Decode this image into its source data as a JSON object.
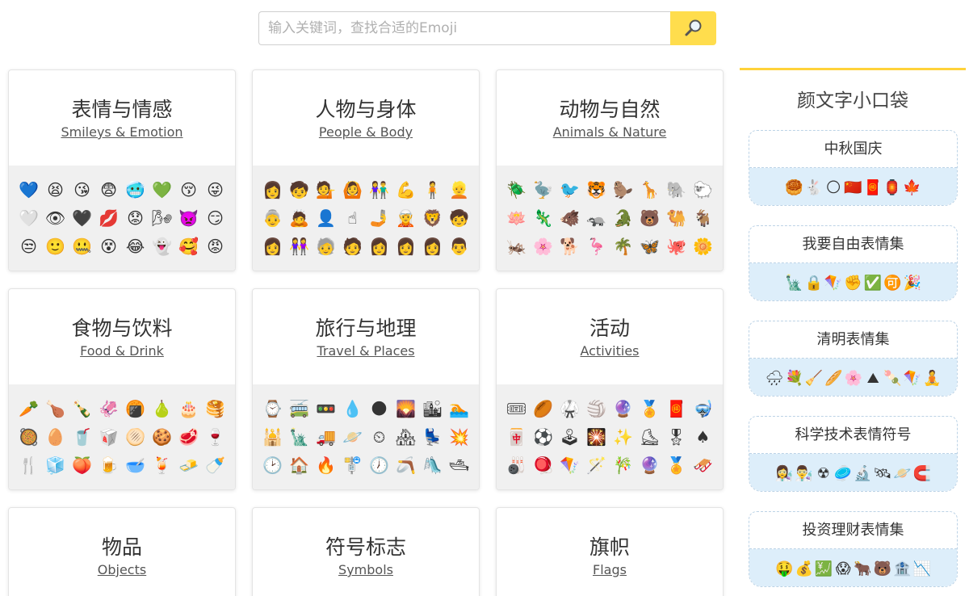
{
  "search": {
    "placeholder": "输入关键词，查找合适的Emoji",
    "button_icon": "magnifier-icon",
    "accent": "#ffdd4d"
  },
  "categories": [
    {
      "title": "表情与情感",
      "subtitle": "Smileys & Emotion",
      "emojis": [
        "💙",
        "😫",
        "😘",
        "😨",
        "🥶",
        "💚",
        "😚",
        "😜",
        "🤍",
        "👁",
        "🖤",
        "💋",
        "😟",
        "🌬",
        "👿",
        "😏",
        "😒",
        "🙂",
        "🤐",
        "😵",
        "😂",
        "👻",
        "🥰",
        "😡"
      ]
    },
    {
      "title": "人物与身体",
      "subtitle": "People & Body",
      "emojis": [
        "👩",
        "🧒",
        "💁",
        "🙆",
        "👫",
        "💪",
        "🧍",
        "👱",
        "👵",
        "🙇",
        "👤",
        "☝",
        "🤳",
        "🧝",
        "🦁",
        "🧒",
        "👩",
        "👭",
        "🧓",
        "🧑",
        "👩",
        "👩",
        "👩",
        "👨"
      ]
    },
    {
      "title": "动物与自然",
      "subtitle": "Animals & Nature",
      "emojis": [
        "🪲",
        "🦤",
        "🐦",
        "🐯",
        "🦫",
        "🦒",
        "🐘",
        "🐑",
        "🪷",
        "🦎",
        "🐗",
        "🦡",
        "🐊",
        "🐻",
        "🐫",
        "🐐",
        "🦗",
        "🌸",
        "🐕",
        "🦩",
        "🌴",
        "🦋",
        "🐙",
        "🌼"
      ]
    },
    {
      "title": "食物与饮料",
      "subtitle": "Food & Drink",
      "emojis": [
        "🥕",
        "🍗",
        "🍾",
        "🦑",
        "🍘",
        "🍐",
        "🎂",
        "🥞",
        "🥘",
        "🥚",
        "🥤",
        "🥡",
        "🫓",
        "🍪",
        "🥩",
        "🍷",
        "🍴",
        "🧊",
        "🍑",
        "🍺",
        "🥣",
        "🍹",
        "🧈",
        "🍼"
      ]
    },
    {
      "title": "旅行与地理",
      "subtitle": "Travel & Places",
      "emojis": [
        "⌚",
        "🚎",
        "🚥",
        "💧",
        "🌑",
        "🌄",
        "🏙",
        "🏊",
        "🕌",
        "🗽",
        "🚚",
        "🪐",
        "⏲",
        "🏘",
        "💺",
        "💥",
        "🕑",
        "🏠",
        "🔥",
        "🚏",
        "🕖",
        "🪃",
        "🛝",
        "🛥"
      ]
    },
    {
      "title": "活动",
      "subtitle": "Activities",
      "emojis": [
        "🎟",
        "🏉",
        "🥋",
        "🏐",
        "🔮",
        "🏅",
        "🧧",
        "🤿",
        "🀄",
        "⚽",
        "🕹",
        "🎇",
        "✨",
        "⛸",
        "🎖",
        "♠",
        "🎳",
        "🪀",
        "🪁",
        "🪄",
        "🎋",
        "🔮",
        "🏅",
        "🛷"
      ]
    },
    {
      "title": "物品",
      "subtitle": "Objects",
      "emojis": []
    },
    {
      "title": "符号标志",
      "subtitle": "Symbols",
      "emojis": []
    },
    {
      "title": "旗帜",
      "subtitle": "Flags",
      "emojis": []
    }
  ],
  "sidebar": {
    "title": "颜文字小口袋",
    "packs": [
      {
        "name": "中秋国庆",
        "emojis": [
          "🥮",
          "🐇",
          "🌕",
          "🇨🇳",
          "🧧",
          "🏮",
          "🍁"
        ]
      },
      {
        "name": "我要自由表情集",
        "emojis": [
          "🗽",
          "🔒",
          "🪁",
          "✊",
          "✅",
          "🉑",
          "🎉"
        ]
      },
      {
        "name": "清明表情集",
        "emojis": [
          "🌧",
          "💐",
          "🧹",
          "🥖",
          "🌸",
          "⛰",
          "🍡",
          "🪁",
          "🧘"
        ]
      },
      {
        "name": "科学技术表情符号",
        "emojis": [
          "👩‍🔬",
          "👨‍🔬",
          "☢",
          "🥏",
          "🔬",
          "🛰",
          "🪐",
          "🧲"
        ]
      },
      {
        "name": "投资理财表情集",
        "emojis": [
          "🤑",
          "💰",
          "💹",
          "😱",
          "🐂",
          "🐻",
          "🏦",
          "📉"
        ]
      }
    ]
  }
}
